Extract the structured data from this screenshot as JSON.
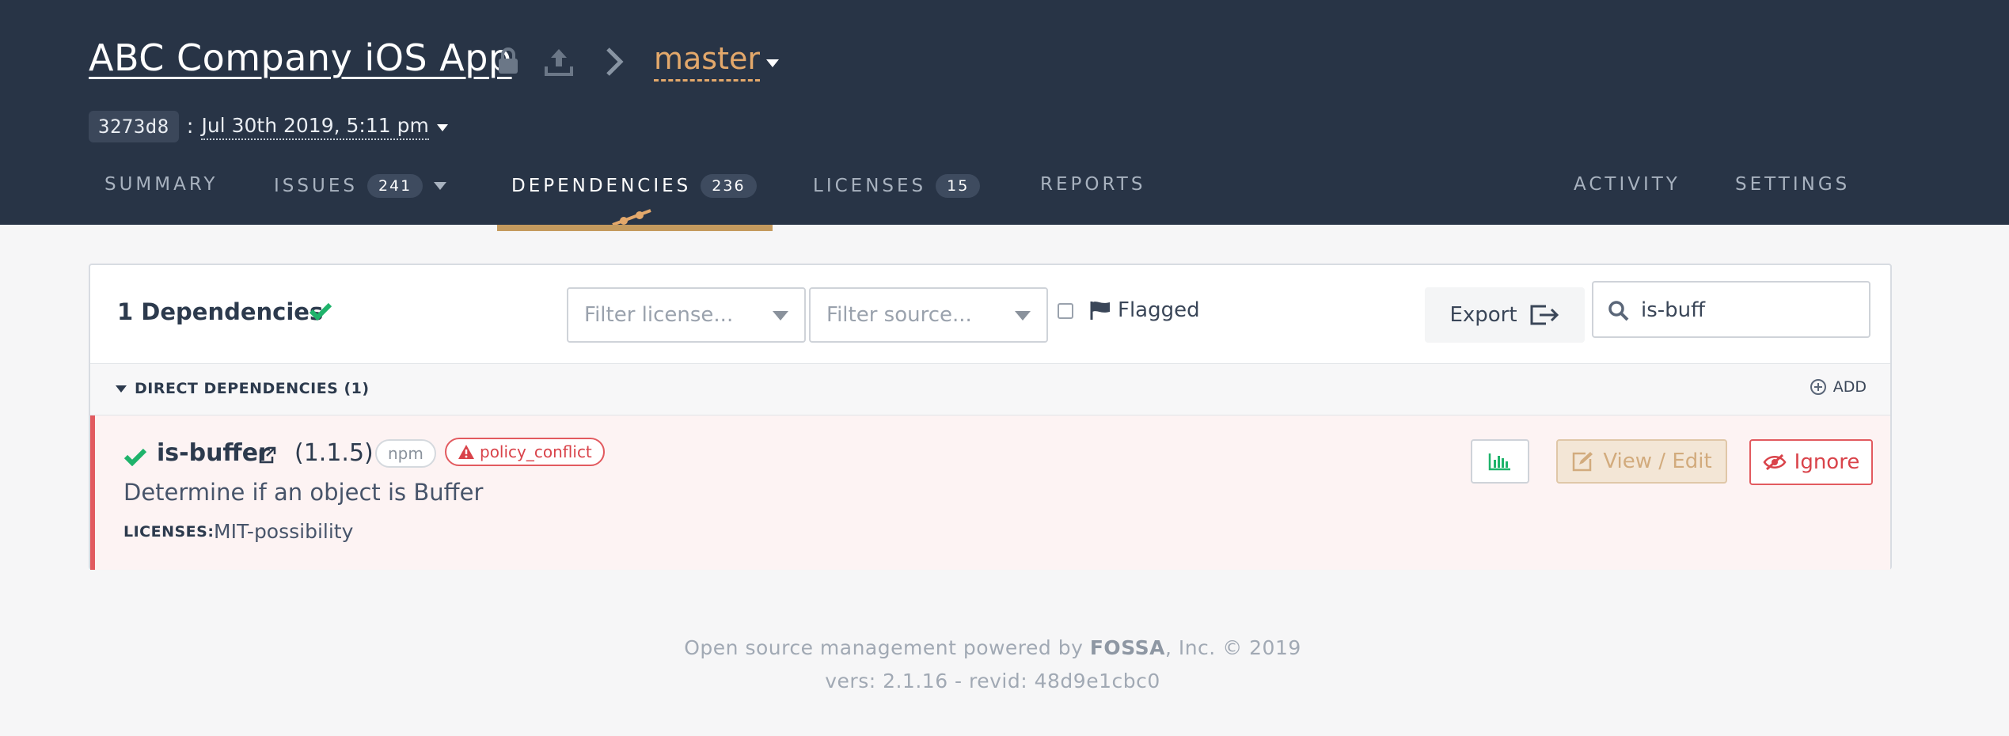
{
  "header": {
    "project_title": "ABC Company iOS App",
    "branch": "master",
    "revision": "3273d8",
    "revision_sep": ":",
    "revision_date": "Jul 30th 2019, 5:11 pm"
  },
  "tabs": [
    {
      "label": "SUMMARY"
    },
    {
      "label": "ISSUES",
      "count": "241"
    },
    {
      "label": "DEPENDENCIES",
      "count": "236",
      "active": true
    },
    {
      "label": "LICENSES",
      "count": "15"
    },
    {
      "label": "REPORTS"
    },
    {
      "label": "ACTIVITY"
    },
    {
      "label": "SETTINGS"
    }
  ],
  "toolbar": {
    "deps_count_label": "1 Dependencies",
    "filter_license_placeholder": "Filter license...",
    "filter_source_placeholder": "Filter source...",
    "flagged_label": "Flagged",
    "export_label": "Export",
    "search_value": "is-buff"
  },
  "section": {
    "title": "DIRECT DEPENDENCIES (1)",
    "add_label": "ADD"
  },
  "dependency": {
    "name": "is-buffer",
    "version": "(1.1.5)",
    "source_tag": "npm",
    "issue_tag": "policy_conflict",
    "description": "Determine if an object is Buffer",
    "licenses_label": "LICENSES:",
    "licenses_value": "MIT-possibility",
    "view_edit_label": "View / Edit",
    "ignore_label": "Ignore"
  },
  "footer": {
    "line1_pre": "Open source management powered by ",
    "line1_brand": "FOSSA",
    "line1_post": ", Inc. © 2019",
    "line2": "vers: 2.1.16 - revid: 48d9e1cbc0"
  },
  "colors": {
    "header_bg": "#283446",
    "accent_branch": "#e3a86b",
    "active_tab_underline": "#c49a5e",
    "success_green": "#1fb36b",
    "danger_red": "#e25a5f"
  }
}
